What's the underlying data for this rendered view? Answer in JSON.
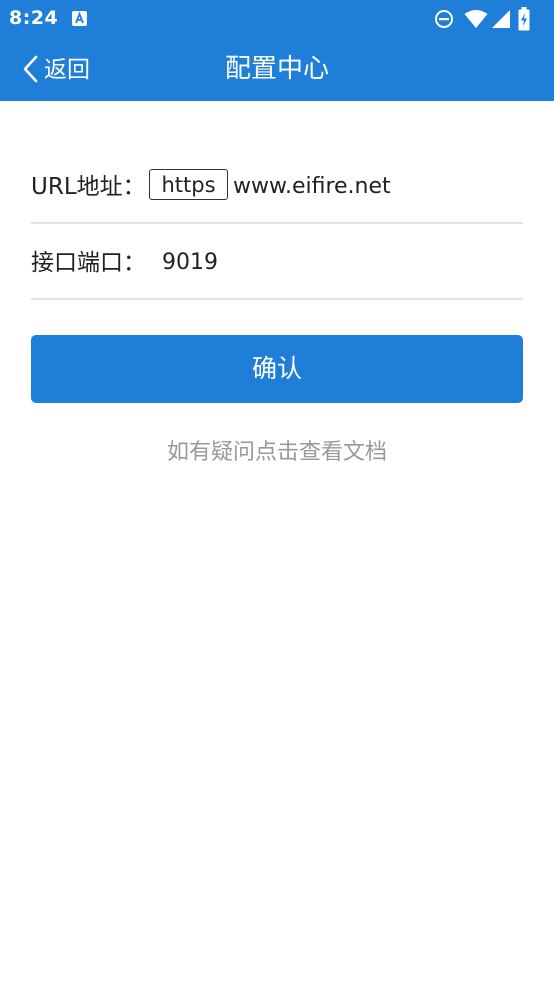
{
  "status_bar": {
    "time": "8:24",
    "icons": [
      "notification-a-icon",
      "do-not-disturb-icon",
      "wifi-icon",
      "cellular-signal-icon",
      "battery-charging-icon"
    ]
  },
  "header": {
    "back_label": "返回",
    "title": "配置中心"
  },
  "form": {
    "url_label": "URL地址：",
    "protocol": "https",
    "url_value": "www.eifire.net",
    "port_label": "接口端口：",
    "port_value": "9019"
  },
  "confirm_label": "确认",
  "help_text": "如有疑问点击查看文档",
  "colors": {
    "primary": "#1f7fd8",
    "divider": "#e3e3e3",
    "muted_text": "#999999"
  }
}
